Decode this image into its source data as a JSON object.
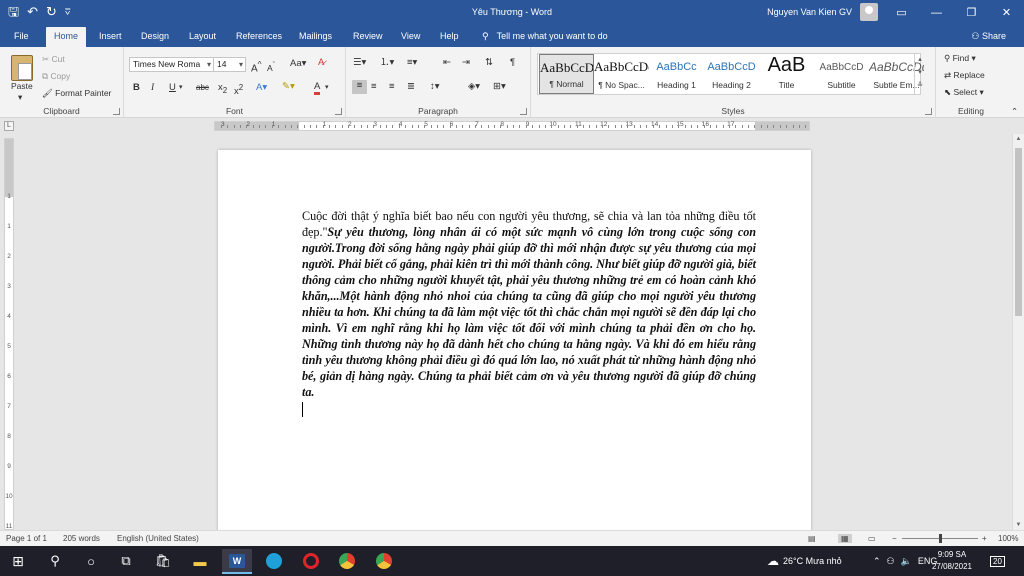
{
  "window": {
    "title": "Yêu Thương - Word",
    "user": "Nguyen Van Kien GV",
    "controls": [
      "ribbon-display",
      "minimize",
      "restore",
      "close"
    ]
  },
  "quick_access": [
    "save-icon",
    "undo-icon",
    "redo-icon",
    "customize-icon"
  ],
  "menu": {
    "tabs": [
      "File",
      "Home",
      "Insert",
      "Design",
      "Layout",
      "References",
      "Mailings",
      "Review",
      "View",
      "Help"
    ],
    "active": "Home",
    "tell_me": "Tell me what you want to do",
    "share": "Share"
  },
  "ribbon": {
    "clipboard": {
      "label": "Clipboard",
      "paste": "Paste",
      "cut": "Cut",
      "copy": "Copy",
      "format_painter": "Format Painter"
    },
    "font": {
      "label": "Font",
      "font_name": "Times New Roma",
      "font_size": "14",
      "grow": "A",
      "shrink": "A",
      "change_case": "Aa",
      "bold": "B",
      "italic": "I",
      "underline": "U",
      "strike": "abc",
      "subscript": "x",
      "superscript": "x",
      "font_color": "A"
    },
    "paragraph": {
      "label": "Paragraph"
    },
    "styles": {
      "label": "Styles",
      "items": [
        {
          "preview": "AaBbCcDc",
          "name": "¶ Normal"
        },
        {
          "preview": "AaBbCcDc",
          "name": "¶ No Spac..."
        },
        {
          "preview": "AaBbCc",
          "name": "Heading 1"
        },
        {
          "preview": "AaBbCcD",
          "name": "Heading 2"
        },
        {
          "preview": "AaB",
          "name": "Title"
        },
        {
          "preview": "AaBbCcD",
          "name": "Subtitle"
        },
        {
          "preview": "AaBbCcDd",
          "name": "Subtle Em..."
        }
      ]
    },
    "editing": {
      "label": "Editing",
      "find": "Find",
      "replace": "Replace",
      "select": "Select"
    }
  },
  "document": {
    "plain": "Cuộc đời thật ý nghĩa biết bao nếu con người yêu thương, sẽ chia và lan tỏa những điều tốt đẹp.\"",
    "bold_italic": "Sự yêu thương, lòng nhân ái có một sức mạnh vô cùng lớn trong cuộc sống con người.Trong đời sống hằng ngày phải giúp đỡ thì mới nhận được sự yêu thương của mọi người. Phải biết cố gắng, phải kiên trì thì mới thành công. Như biết giúp đỡ người già, biết thông cảm cho những người khuyết tật, phải yêu thương những trẻ em có hoàn cảnh khó khăn,...Một hành động nhỏ nhoi của chúng ta cũng đã giúp cho mọi người yêu thương nhiều ta hơn. Khi chúng ta đã làm một việc tốt thì chắc chắn mọi người sẽ đền đáp lại cho mình. Vì em nghĩ rằng khi họ làm việc tốt đối với mình chúng ta phải đền ơn cho họ. Những tình thương này họ đã dành hết cho chúng ta hằng ngày. Và khi đó em hiểu rằng tình yêu thương không phải điều gì đó quá lớn lao, nó xuất phát từ những hành động nhỏ bé, giản dị hàng ngày. Chúng ta phải biết cảm ơn và yêu thương người đã giúp đỡ chúng ta."
  },
  "ruler": {
    "h_labels": [
      "3",
      "2",
      "1",
      "1",
      "2",
      "3",
      "4",
      "5",
      "6",
      "7",
      "8",
      "9",
      "10",
      "11",
      "12",
      "13",
      "14",
      "15",
      "16",
      "17"
    ],
    "v_labels": [
      "1",
      "1",
      "2",
      "3",
      "4",
      "5",
      "6",
      "7",
      "8",
      "9",
      "10",
      "11"
    ]
  },
  "status": {
    "page": "Page 1 of 1",
    "words": "205 words",
    "language": "English (United States)",
    "zoom": "100%"
  },
  "taskbar": {
    "weather": "26°C  Mưa nhỏ",
    "lang": "ENG",
    "time": "9:09 SA",
    "date": "27/08/2021",
    "notifications": "20"
  }
}
